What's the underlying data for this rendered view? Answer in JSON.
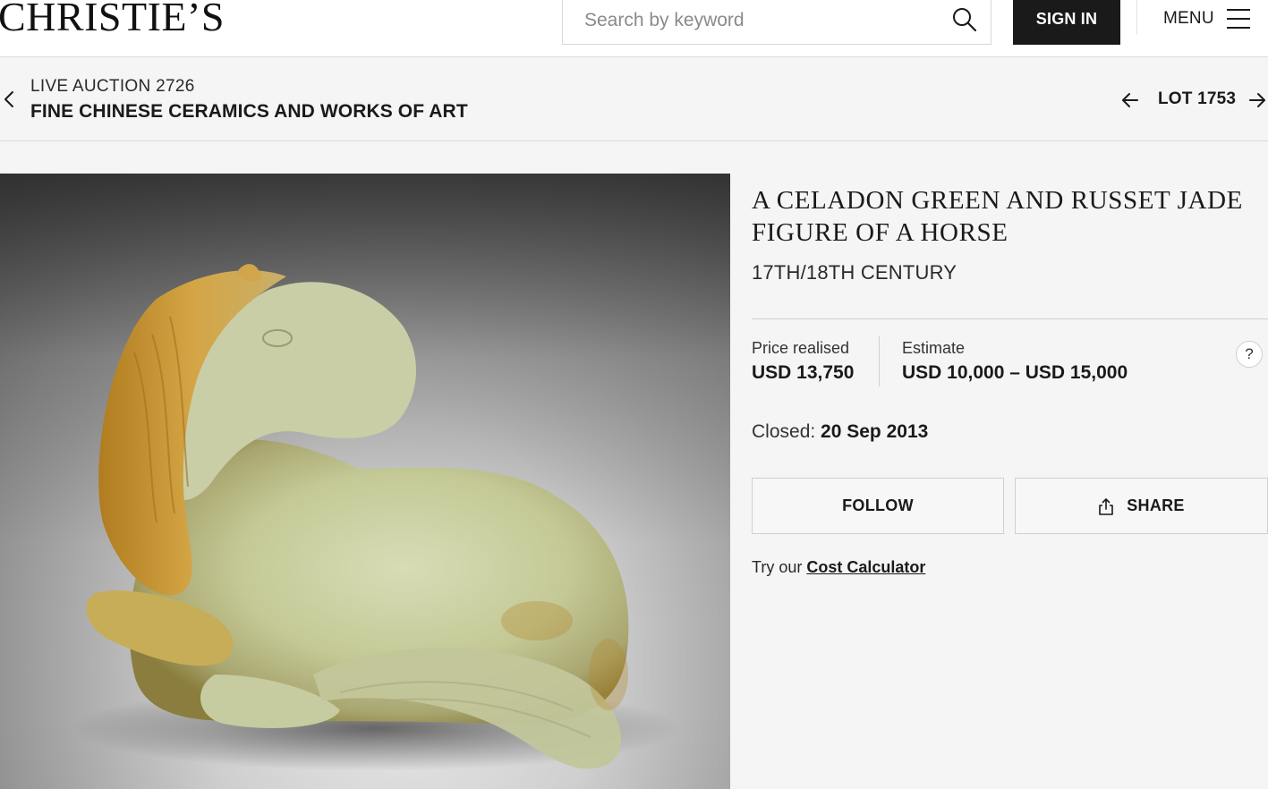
{
  "header": {
    "logo": "CHRISTIE’S",
    "search_placeholder": "Search by keyword",
    "sign_in_label": "SIGN IN",
    "menu_label": "MENU"
  },
  "breadcrumb": {
    "auction_label": "LIVE AUCTION 2726",
    "auction_title": "FINE CHINESE CERAMICS AND WORKS OF ART",
    "lot_label": "LOT 1753"
  },
  "lot": {
    "title": "A CELADON GREEN AND RUSSET JADE FIGURE OF A HORSE",
    "subtitle": "17TH/18TH CENTURY",
    "price_label": "Price realised",
    "price_value": "USD 13,750",
    "estimate_label": "Estimate",
    "estimate_value": "USD 10,000 – USD 15,000",
    "help_label": "?",
    "closed_label": "Closed:",
    "closed_date": "20 Sep 2013",
    "follow_label": "FOLLOW",
    "share_label": "SHARE",
    "cost_prefix": "Try our",
    "cost_link": "Cost Calculator"
  },
  "icons": {
    "search": "search-icon",
    "menu": "hamburger-icon",
    "back": "chevron-left-icon",
    "prev": "arrow-left-icon",
    "next": "arrow-right-icon",
    "share": "share-icon"
  },
  "colors": {
    "accent": "#1a1a1a",
    "background": "#f5f5f5",
    "jade": "#c9cfa0",
    "russet": "#c9972f"
  }
}
